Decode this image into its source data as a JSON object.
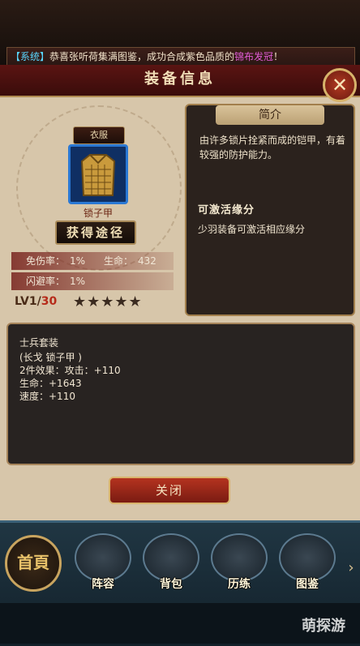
{
  "system_message": {
    "tag": "【系统】",
    "prefix": "恭喜张听荷集满图鉴，成功合成紫色品质的",
    "item": "锦布发冠",
    "suffix": "！"
  },
  "header": {
    "title": "装备信息",
    "close_icon": "close-x-icon"
  },
  "item": {
    "slot": "衣服",
    "name": "锁子甲",
    "source_button": "获得途径",
    "stats": [
      {
        "label": "免伤率：",
        "value": "1%"
      },
      {
        "label": "生命：",
        "value": "432"
      },
      {
        "label": "闪避率：",
        "value": "1%"
      }
    ],
    "level_current": "LV1",
    "level_sep": "/",
    "level_max": "30",
    "stars": "★★★★★"
  },
  "intro": {
    "heading": "简介",
    "description": "由许多锁片拴紧而成的铠甲，有着较强的防护能力。",
    "fate_title": "可激活缘分",
    "fate_desc": "少羽装备可激活相应缘分"
  },
  "set": {
    "lines": [
      "士兵套装",
      "(长戈 锁子甲 )",
      "2件效果：攻击：+110",
      "生命：+1643",
      "速度：+110"
    ]
  },
  "close_button": "关闭",
  "nav": {
    "home_glyph": "首頁",
    "items": [
      {
        "label": "阵容",
        "icon": "lineup-icon"
      },
      {
        "label": "背包",
        "icon": "backpack-icon"
      },
      {
        "label": "历练",
        "icon": "swords-icon"
      },
      {
        "label": "图鉴",
        "icon": "scroll-icon"
      }
    ],
    "more": "›"
  },
  "watermark": "萌探游"
}
